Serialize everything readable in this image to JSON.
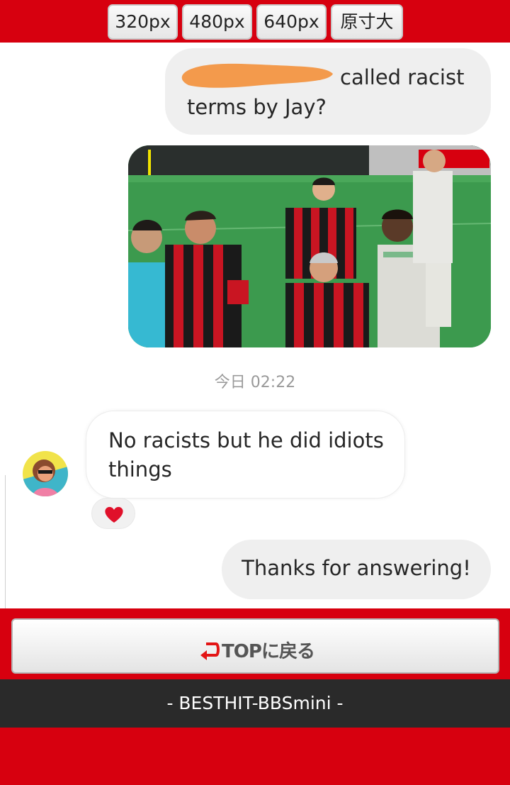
{
  "size_buttons": [
    "320px",
    "480px",
    "640px",
    "原寸大"
  ],
  "messages": {
    "question": {
      "text": "called racist terms by Jay?",
      "redaction_color": "#f39a4c"
    },
    "timestamp": "今日 02:22",
    "reply": {
      "text": "No racists but he did idiots things",
      "reaction": "heart-emoji"
    },
    "thanks": {
      "text": "Thanks for answering!"
    }
  },
  "top_button": {
    "label": "TOPに戻る",
    "icon": "return-arrow-icon"
  },
  "footer": {
    "text": "- BESTHIT-BBSmini -"
  },
  "colors": {
    "brand_red": "#d7000f",
    "bubble_gray": "#efefef",
    "footer_dark": "#2a2a2a",
    "heart": "#e0102a"
  }
}
